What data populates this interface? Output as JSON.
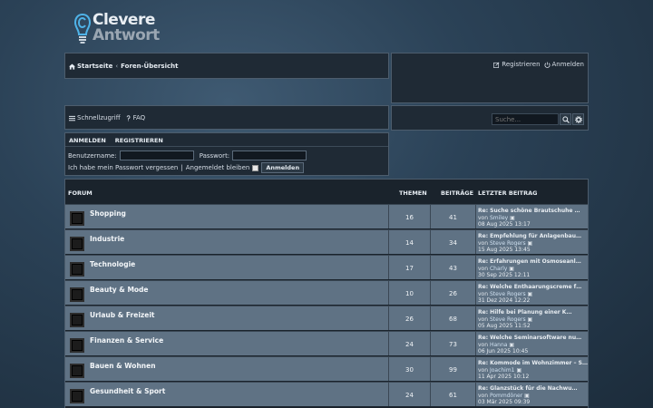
{
  "logo": {
    "line1": "Clevere",
    "line2": "Antwort",
    "color": "#4fb3e8"
  },
  "nav": {
    "home": "Startseite",
    "separator": "‹",
    "current": "Foren-Übersicht"
  },
  "toplinks": {
    "register": "Registrieren",
    "login": "Anmelden"
  },
  "quick": {
    "quicklink": "Schnellzugriff",
    "faq": "FAQ"
  },
  "search": {
    "placeholder": "Suche..."
  },
  "login": {
    "tab_login": "ANMELDEN",
    "tab_register": "REGISTRIEREN",
    "username_label": "Benutzername:",
    "password_label": "Passwort:",
    "forgot": "Ich habe mein Passwort vergessen",
    "divider": "|",
    "remember": "Angemeldet bleiben",
    "submit": "Anmelden"
  },
  "forum": {
    "headers": {
      "forum": "FORUM",
      "topics": "THEMEN",
      "posts": "BEITRÄGE",
      "last": "LETZTER BEITRAG"
    },
    "rows": [
      {
        "name": "Shopping",
        "topics": "16",
        "posts": "41",
        "last_title": "Re: Suche schöne Brautschuhe …",
        "by": "von",
        "author": "Smiley",
        "date": "08 Aug 2025 13:17"
      },
      {
        "name": "Industrie",
        "topics": "14",
        "posts": "34",
        "last_title": "Re: Empfehlung für Anlagenbau…",
        "by": "von",
        "author": "Steve Rogers",
        "date": "15 Aug 2025 13:45"
      },
      {
        "name": "Technologie",
        "topics": "17",
        "posts": "43",
        "last_title": "Re: Erfahrungen mit Osmoseanl…",
        "by": "von",
        "author": "Charly",
        "date": "30 Sep 2025 12:11"
      },
      {
        "name": "Beauty & Mode",
        "topics": "10",
        "posts": "26",
        "last_title": "Re: Welche Enthaarungscreme f…",
        "by": "von",
        "author": "Steve Rogers",
        "date": "31 Dez 2024 12:22"
      },
      {
        "name": "Urlaub & Freizeit",
        "topics": "26",
        "posts": "68",
        "last_title": "Re: Hilfe bei Planung einer K…",
        "by": "von",
        "author": "Steve Rogers",
        "date": "05 Aug 2025 11:52"
      },
      {
        "name": "Finanzen & Service",
        "topics": "24",
        "posts": "73",
        "last_title": "Re: Welche Seminarsoftware nu…",
        "by": "von",
        "author": "Hanna",
        "date": "06 Jun 2025 10:45"
      },
      {
        "name": "Bauen & Wohnen",
        "topics": "30",
        "posts": "99",
        "last_title": "Re: Kommode im Wohnzimmer – S…",
        "by": "von",
        "author": "Joachim1",
        "date": "11 Apr 2025 10:12"
      },
      {
        "name": "Gesundheit & Sport",
        "topics": "24",
        "posts": "61",
        "last_title": "Re: Glanzstück für die Nachwu…",
        "by": "von",
        "author": "Pommdöner",
        "date": "03 Mär 2025 09:39"
      }
    ]
  }
}
